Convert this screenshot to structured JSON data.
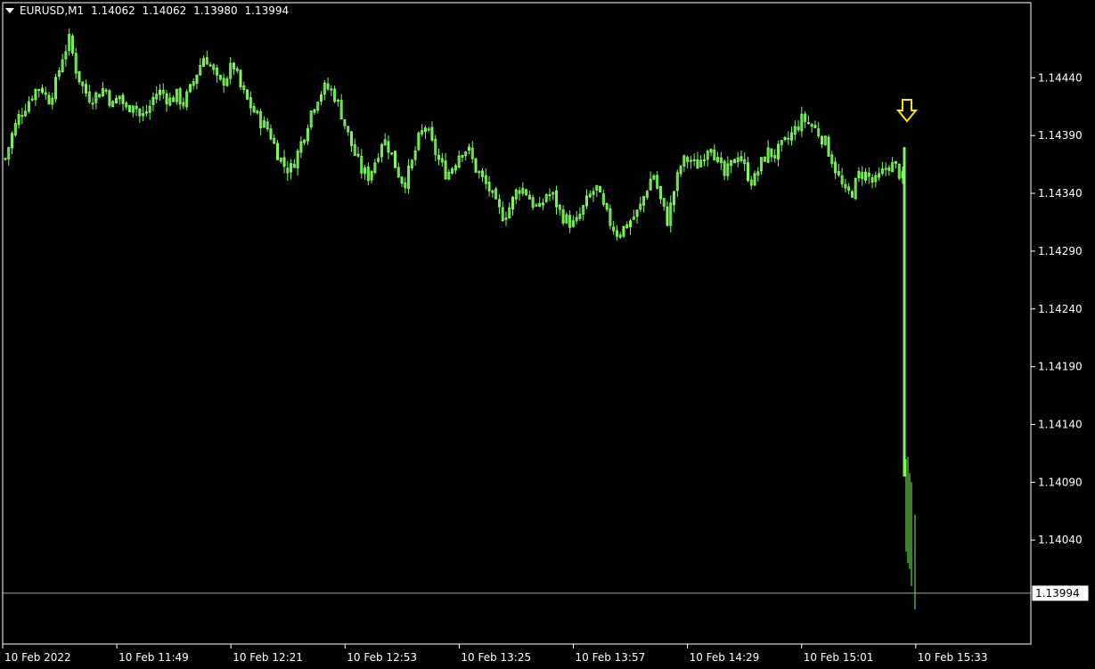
{
  "header": {
    "symbol": "EURUSD,M1",
    "open": "1.14062",
    "high": "1.14062",
    "low": "1.13980",
    "close": "1.13994"
  },
  "colors": {
    "background": "#000000",
    "candle": "#7CFC5A",
    "arrow": "#FFE400",
    "axis": "#FFFFFF",
    "bid_line": "#A0A0A0"
  },
  "current_price": {
    "value": 1.13994,
    "label": "1.13994"
  },
  "signal_arrow": {
    "icon": "down-arrow-icon",
    "time": "10 Feb 15:25",
    "price": 1.14384
  },
  "chart_data": {
    "type": "candlestick",
    "timeframe": "M1",
    "grid": false,
    "ylim": [
      1.1395,
      1.14505
    ],
    "y_ticks": [
      "1.14440",
      "1.14390",
      "1.14340",
      "1.14290",
      "1.14240",
      "1.14190",
      "1.14140",
      "1.14090",
      "1.14040"
    ],
    "y_tick_values": [
      1.1444,
      1.1439,
      1.1434,
      1.1429,
      1.1424,
      1.1419,
      1.1414,
      1.1409,
      1.1404
    ],
    "x_ticks": [
      "10 Feb 2022",
      "10 Feb 11:49",
      "10 Feb 12:21",
      "10 Feb 12:53",
      "10 Feb 13:25",
      "10 Feb 13:57",
      "10 Feb 14:29",
      "10 Feb 15:01",
      "10 Feb 15:33"
    ],
    "close_path": [
      1.1437,
      1.14392,
      1.14408,
      1.14417,
      1.14428,
      1.14433,
      1.1442,
      1.14433,
      1.14458,
      1.14473,
      1.14445,
      1.1443,
      1.14422,
      1.14426,
      1.14432,
      1.14415,
      1.14425,
      1.14412,
      1.1442,
      1.14405,
      1.14411,
      1.14426,
      1.14428,
      1.1442,
      1.14425,
      1.14418,
      1.1443,
      1.14446,
      1.1446,
      1.14448,
      1.14434,
      1.1444,
      1.14452,
      1.14432,
      1.1442,
      1.1441,
      1.14401,
      1.14395,
      1.14378,
      1.14365,
      1.1436,
      1.14374,
      1.14392,
      1.14412,
      1.14425,
      1.14432,
      1.14428,
      1.14413,
      1.14393,
      1.14375,
      1.1436,
      1.14355,
      1.14369,
      1.14388,
      1.14378,
      1.1436,
      1.14348,
      1.14364,
      1.14386,
      1.14398,
      1.14381,
      1.14367,
      1.14356,
      1.14365,
      1.14378,
      1.14378,
      1.14362,
      1.14352,
      1.14343,
      1.14328,
      1.1432,
      1.1433,
      1.14345,
      1.14343,
      1.14332,
      1.14325,
      1.1434,
      1.14337,
      1.14322,
      1.14316,
      1.14312,
      1.14325,
      1.14337,
      1.14345,
      1.14327,
      1.14314,
      1.14305,
      1.14311,
      1.14318,
      1.14325,
      1.14343,
      1.14358,
      1.14334,
      1.14316,
      1.14345,
      1.14367,
      1.1437,
      1.14363,
      1.14372,
      1.14385,
      1.14367,
      1.14355,
      1.14365,
      1.14376,
      1.14359,
      1.14349,
      1.14364,
      1.14376,
      1.14373,
      1.1438,
      1.14387,
      1.14396,
      1.14405,
      1.144,
      1.14394,
      1.14386,
      1.14371,
      1.14354,
      1.14339,
      1.14342,
      1.14358,
      1.14356,
      1.14348,
      1.14356,
      1.14365,
      1.14363,
      1.14353,
      1.14062,
      1.13994
    ]
  }
}
